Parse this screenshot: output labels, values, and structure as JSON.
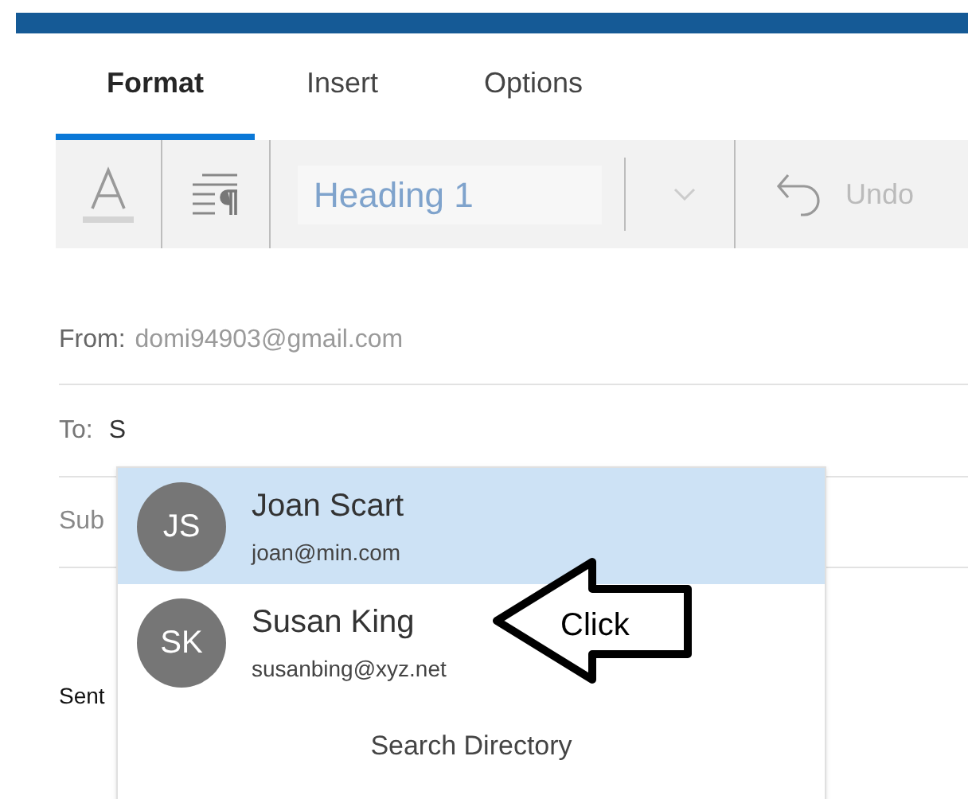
{
  "tabs": [
    {
      "label": "Format",
      "selected": true
    },
    {
      "label": "Insert",
      "selected": false
    },
    {
      "label": "Options",
      "selected": false
    }
  ],
  "toolbar": {
    "style_field": {
      "value": "Heading 1"
    },
    "undo": "Undo"
  },
  "from": {
    "label": "From:",
    "value": "domi94903@gmail.com"
  },
  "to": {
    "label": "To:",
    "value": "S"
  },
  "subject": {
    "label": "Sub"
  },
  "sent_label": "Sent",
  "suggestions": [
    {
      "initials": "JS",
      "name": "Joan Scart",
      "email": "joan@min.com",
      "selected": true
    },
    {
      "initials": "SK",
      "name": "Susan King",
      "email": "susanbing@xyz.net",
      "selected": false
    }
  ],
  "search_directory": "Search Directory",
  "annotation": {
    "text": "Click"
  }
}
